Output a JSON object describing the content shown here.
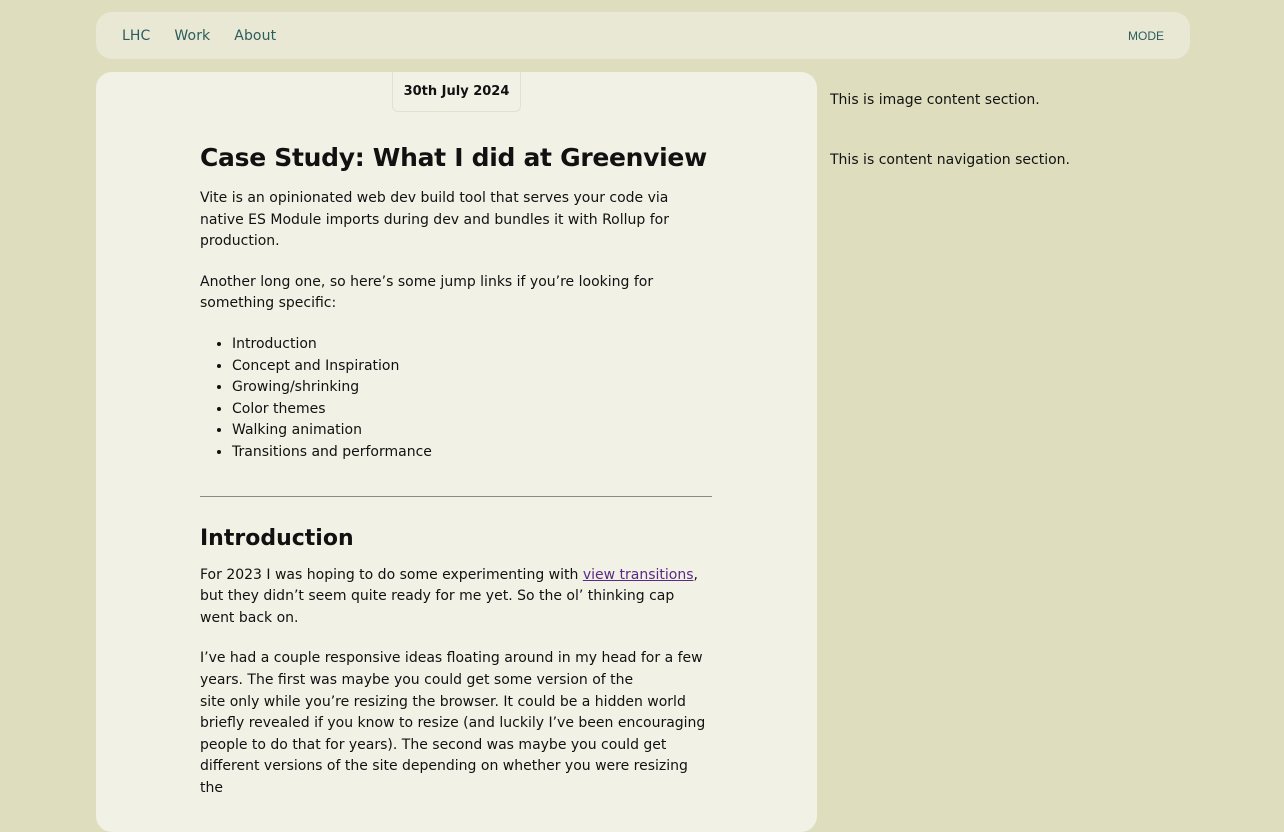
{
  "nav": {
    "links": [
      "LHC",
      "Work",
      "About"
    ],
    "mode_label": "MODE"
  },
  "article": {
    "date": "30th July 2024",
    "title": "Case Study: What I did at Greenview",
    "intro_paragraphs": [
      "Vite is an opinionated web dev build tool that serves your code via native ES Module imports during dev and bundles it with Rollup for production.",
      "Another long one, so here’s some jump links if you’re looking for something specific:"
    ],
    "jump_links": [
      "Introduction",
      "Concept and Inspiration",
      "Growing/shrinking",
      "Color themes",
      "Walking animation",
      "Transitions and performance"
    ],
    "section": {
      "heading": "Introduction",
      "p1_before": "For 2023 I was hoping to do some experimenting with ",
      "p1_link": "view transitions",
      "p1_after": ", but they didn’t seem quite ready for me yet. So the ol’ thinking cap went back on.",
      "p2_line1": "I’ve had a couple responsive ideas floating around in my head for a few years. The first was maybe you could get some version of the",
      "p2_line2": "site only while you’re resizing the browser. It could be a hidden world briefly revealed if you know to resize (and luckily I’ve been encouraging people to do that for years). The second was maybe you could get different versions of the site depending on whether you were resizing the"
    }
  },
  "aside": {
    "image_section": "This is image content section.",
    "nav_section": "This is content navigation section."
  }
}
